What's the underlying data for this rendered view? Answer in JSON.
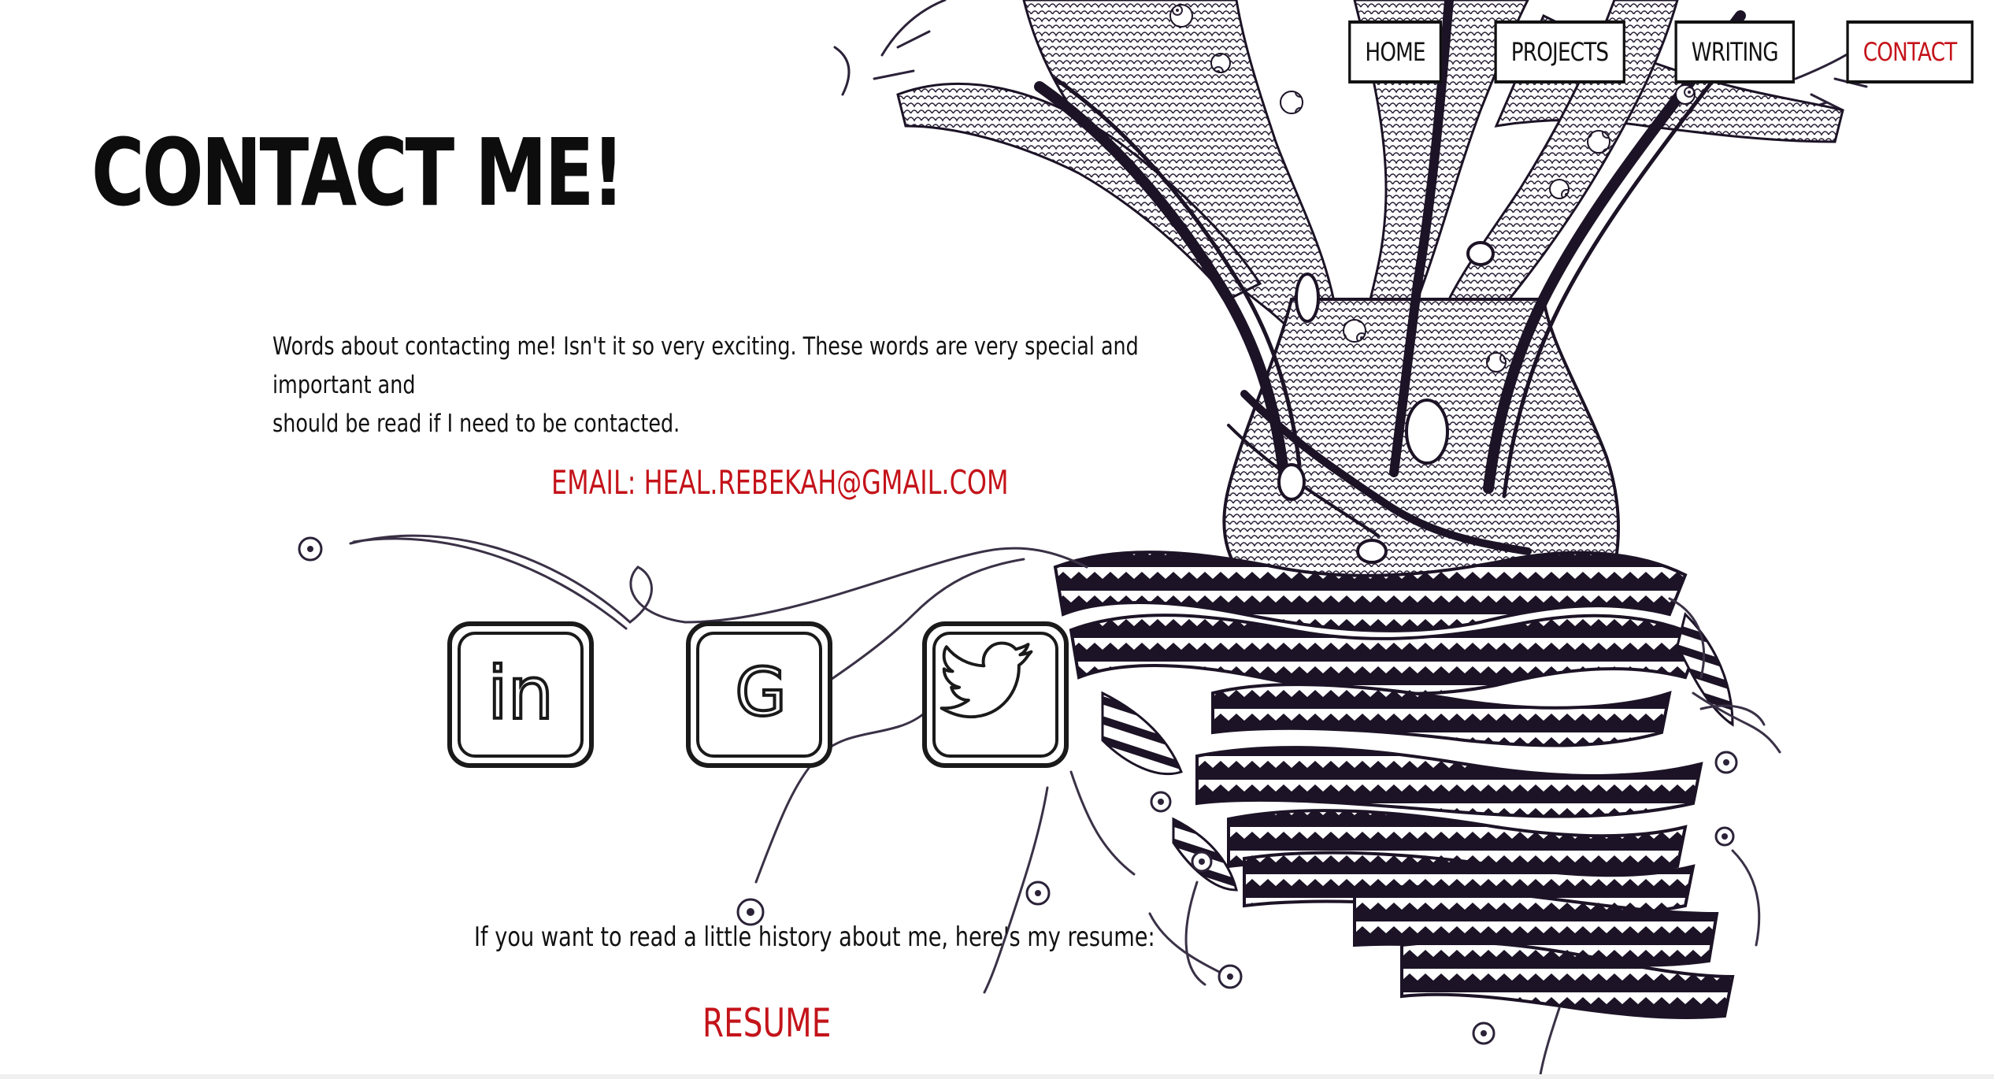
{
  "nav": {
    "items": [
      {
        "label": "HOME",
        "active": false
      },
      {
        "label": "PROJECTS",
        "active": false
      },
      {
        "label": "WRITING",
        "active": false
      },
      {
        "label": "CONTACT",
        "active": true
      }
    ]
  },
  "main": {
    "title": "CONTACT ME!",
    "intro_line_1": "Words about contacting me! Isn't it so very exciting. These words are very special and important and",
    "intro_line_2": "should be read if I need to be contacted.",
    "email_label": "EMAIL: HEAL.REBEKAH@GMAIL.COM",
    "social": [
      {
        "name": "linkedin",
        "icon": "linkedin-icon",
        "glyph": "in"
      },
      {
        "name": "google",
        "icon": "google-icon",
        "glyph": "G"
      },
      {
        "name": "twitter",
        "icon": "twitter-icon"
      }
    ],
    "resume_text": "If you want to read a little history about me, here's my resume:",
    "resume_label": "RESUME"
  },
  "colors": {
    "accent": "#c4131a",
    "ink": "#111111",
    "tree_ink": "#241a33",
    "background": "#ffffff"
  },
  "artwork": {
    "subject": "ink-drawing-tree-illustration"
  }
}
